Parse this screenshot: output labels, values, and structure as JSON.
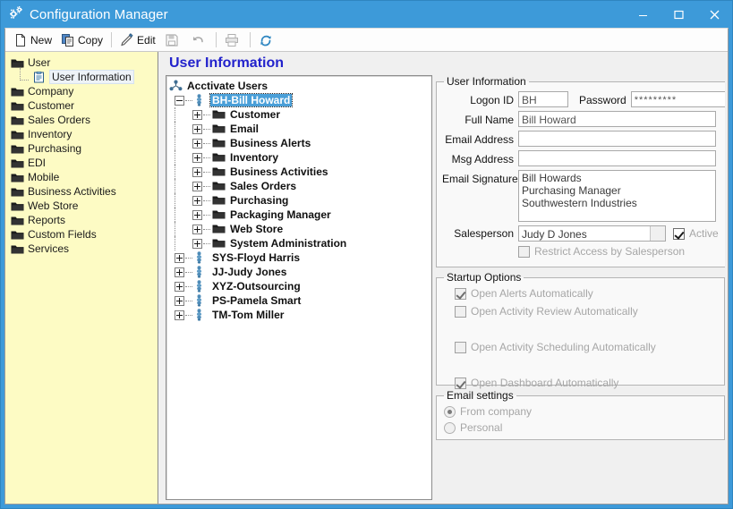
{
  "window": {
    "title": "Configuration Manager",
    "app_icon": "gears-icon",
    "controls": {
      "minimize": "–",
      "maximize": "❐",
      "close": "✕"
    },
    "accent_color": "#3d9ad9"
  },
  "toolbar": {
    "items": [
      {
        "label": "New",
        "icon": "new-document-icon",
        "enabled": true
      },
      {
        "label": "Copy",
        "icon": "copy-icon",
        "enabled": true
      },
      {
        "label": "Edit",
        "icon": "pencil-icon",
        "enabled": true
      },
      {
        "label": "",
        "icon": "save-icon",
        "enabled": false
      },
      {
        "label": "",
        "icon": "undo-icon",
        "enabled": false
      },
      {
        "label": "",
        "icon": "print-icon",
        "enabled": false
      },
      {
        "label": "",
        "icon": "refresh-icon",
        "enabled": true
      }
    ]
  },
  "sidebar": {
    "background_color": "#fdfbc4",
    "items": [
      {
        "label": "User",
        "icon": "folder-open-icon",
        "level": 0,
        "selected": false
      },
      {
        "label": "User Information",
        "icon": "form-icon",
        "level": 1,
        "selected": true
      },
      {
        "label": "Company",
        "icon": "folder-icon",
        "level": 0,
        "selected": false
      },
      {
        "label": "Customer",
        "icon": "folder-icon",
        "level": 0,
        "selected": false
      },
      {
        "label": "Sales Orders",
        "icon": "folder-icon",
        "level": 0,
        "selected": false
      },
      {
        "label": "Inventory",
        "icon": "folder-icon",
        "level": 0,
        "selected": false
      },
      {
        "label": "Purchasing",
        "icon": "folder-icon",
        "level": 0,
        "selected": false
      },
      {
        "label": "EDI",
        "icon": "folder-icon",
        "level": 0,
        "selected": false
      },
      {
        "label": "Mobile",
        "icon": "folder-icon",
        "level": 0,
        "selected": false
      },
      {
        "label": "Business Activities",
        "icon": "folder-icon",
        "level": 0,
        "selected": false
      },
      {
        "label": "Web Store",
        "icon": "folder-icon",
        "level": 0,
        "selected": false
      },
      {
        "label": "Reports",
        "icon": "folder-icon",
        "level": 0,
        "selected": false
      },
      {
        "label": "Custom Fields",
        "icon": "folder-icon",
        "level": 0,
        "selected": false
      },
      {
        "label": "Services",
        "icon": "folder-icon",
        "level": 0,
        "selected": false
      }
    ]
  },
  "page": {
    "heading": "User Information"
  },
  "tree": {
    "selection_color": "#4a9fd8",
    "nodes": [
      {
        "label": "Acctivate Users",
        "icon": "users-group-icon",
        "level": 0,
        "expander": "none",
        "selected": false
      },
      {
        "label": "BH-Bill Howard",
        "icon": "user-icon",
        "level": 1,
        "expander": "minus",
        "selected": true
      },
      {
        "label": "Customer",
        "icon": "folder-icon",
        "level": 2,
        "expander": "plus",
        "selected": false
      },
      {
        "label": "Email",
        "icon": "folder-icon",
        "level": 2,
        "expander": "plus",
        "selected": false
      },
      {
        "label": "Business Alerts",
        "icon": "folder-icon",
        "level": 2,
        "expander": "plus",
        "selected": false
      },
      {
        "label": "Inventory",
        "icon": "folder-icon",
        "level": 2,
        "expander": "plus",
        "selected": false
      },
      {
        "label": "Business Activities",
        "icon": "folder-icon",
        "level": 2,
        "expander": "plus",
        "selected": false
      },
      {
        "label": "Sales Orders",
        "icon": "folder-icon",
        "level": 2,
        "expander": "plus",
        "selected": false
      },
      {
        "label": "Purchasing",
        "icon": "folder-icon",
        "level": 2,
        "expander": "plus",
        "selected": false
      },
      {
        "label": "Packaging Manager",
        "icon": "folder-icon",
        "level": 2,
        "expander": "plus",
        "selected": false
      },
      {
        "label": "Web Store",
        "icon": "folder-icon",
        "level": 2,
        "expander": "plus",
        "selected": false
      },
      {
        "label": "System Administration",
        "icon": "folder-icon",
        "level": 2,
        "expander": "plus",
        "selected": false
      },
      {
        "label": "SYS-Floyd Harris",
        "icon": "user-icon",
        "level": 1,
        "expander": "plus",
        "selected": false
      },
      {
        "label": "JJ-Judy Jones",
        "icon": "user-icon",
        "level": 1,
        "expander": "plus",
        "selected": false
      },
      {
        "label": "XYZ-Outsourcing",
        "icon": "user-icon",
        "level": 1,
        "expander": "plus",
        "selected": false
      },
      {
        "label": "PS-Pamela Smart",
        "icon": "user-icon",
        "level": 1,
        "expander": "plus",
        "selected": false
      },
      {
        "label": "TM-Tom Miller",
        "icon": "user-icon",
        "level": 1,
        "expander": "plus",
        "selected": false
      }
    ]
  },
  "user_info": {
    "legend": "User Information",
    "logon_id": {
      "label": "Logon ID",
      "value": "BH"
    },
    "password": {
      "label": "Password",
      "value": "*********"
    },
    "full_name": {
      "label": "Full Name",
      "value": "Bill Howard"
    },
    "email_address": {
      "label": "Email Address",
      "value": ""
    },
    "msg_address": {
      "label": "Msg Address",
      "value": ""
    },
    "email_signature": {
      "label": "Email Signature",
      "value": "Bill Howards\nPurchasing Manager\nSouthwestern Industries"
    },
    "salesperson": {
      "label": "Salesperson",
      "value": "Judy D Jones"
    },
    "active": {
      "label": "Active",
      "checked": true,
      "enabled": false
    },
    "restrict_access": {
      "label": "Restrict Access by Salesperson",
      "checked": false,
      "enabled": false
    }
  },
  "startup_options": {
    "legend": "Startup Options",
    "options": [
      {
        "label": "Open Alerts Automatically",
        "checked": true,
        "enabled": false
      },
      {
        "label": "Open Activity Review Automatically",
        "checked": false,
        "enabled": false
      },
      {
        "label": "Open Activity Scheduling Automatically",
        "checked": false,
        "enabled": false
      },
      {
        "label": "Open Dashboard Automatically",
        "checked": true,
        "enabled": false
      }
    ]
  },
  "email_settings": {
    "legend": "Email settings",
    "options": [
      {
        "label": "From company",
        "selected": true,
        "enabled": false
      },
      {
        "label": "Personal",
        "selected": false,
        "enabled": false
      }
    ]
  }
}
